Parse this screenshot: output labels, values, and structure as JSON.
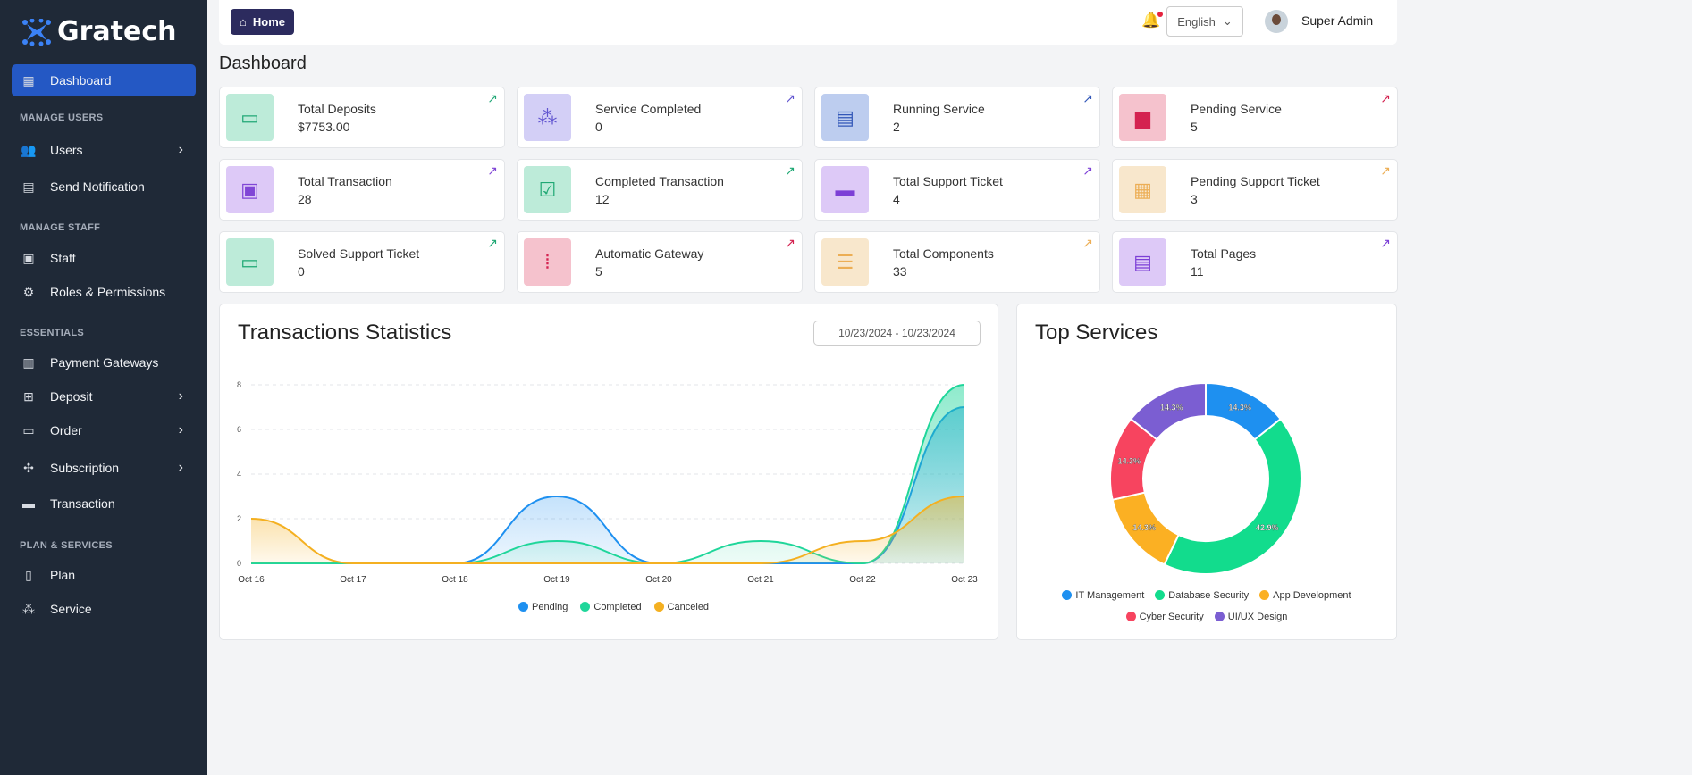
{
  "brand": "Gratech",
  "sidebar": {
    "items": [
      {
        "label": "Dashboard",
        "icon": "dashboard-icon",
        "glyph": "▦",
        "y": 72,
        "active": true
      },
      {
        "section": "MANAGE USERS",
        "y": 126
      },
      {
        "label": "Users",
        "icon": "users-icon",
        "glyph": "👥",
        "y": 150,
        "chevron": true
      },
      {
        "label": "Send Notification",
        "icon": "notification-icon",
        "glyph": "▤",
        "y": 191
      },
      {
        "section": "MANAGE STAFF",
        "y": 249
      },
      {
        "label": "Staff",
        "icon": "staff-icon",
        "glyph": "▣",
        "y": 271
      },
      {
        "label": "Roles & Permissions",
        "icon": "roles-icon",
        "glyph": "⚙",
        "y": 309
      },
      {
        "section": "ESSENTIALS",
        "y": 367
      },
      {
        "label": "Payment Gateways",
        "icon": "payment-gateway-icon",
        "glyph": "▥",
        "y": 388
      },
      {
        "label": "Deposit",
        "icon": "deposit-icon",
        "glyph": "⊞",
        "y": 426,
        "chevron": true
      },
      {
        "label": "Order",
        "icon": "order-icon",
        "glyph": "▭",
        "y": 464,
        "chevron": true
      },
      {
        "label": "Subscription",
        "icon": "subscription-icon",
        "glyph": "✣",
        "y": 506,
        "chevron": true
      },
      {
        "label": "Transaction",
        "icon": "transaction-icon",
        "glyph": "▬",
        "y": 546
      },
      {
        "section": "PLAN & SERVICES",
        "y": 605
      },
      {
        "label": "Plan",
        "icon": "plan-icon",
        "glyph": "▯",
        "y": 626
      },
      {
        "label": "Service",
        "icon": "service-icon",
        "glyph": "⁂",
        "y": 664
      }
    ]
  },
  "topbar": {
    "home": "Home",
    "language": "English",
    "user": "Super Admin"
  },
  "page_title": "Dashboard",
  "cards": [
    {
      "title": "Total Deposits",
      "value": "$7753.00",
      "bg": "#bdebd9",
      "fg": "#22a877",
      "glyph": "▭"
    },
    {
      "title": "Service Completed",
      "value": "0",
      "bg": "#d3cff6",
      "fg": "#6155d0",
      "glyph": "⁂"
    },
    {
      "title": "Running Service",
      "value": "2",
      "bg": "#bdcdef",
      "fg": "#3257b8",
      "glyph": "▤"
    },
    {
      "title": "Pending Service",
      "value": "5",
      "bg": "#f5c2cd",
      "fg": "#d42250",
      "glyph": "▆"
    },
    {
      "title": "Total Transaction",
      "value": "28",
      "bg": "#ddc9f7",
      "fg": "#8046d6",
      "glyph": "▣"
    },
    {
      "title": "Completed Transaction",
      "value": "12",
      "bg": "#bdebd9",
      "fg": "#1fa874",
      "glyph": "☑"
    },
    {
      "title": "Total Support Ticket",
      "value": "4",
      "bg": "#ddc9f7",
      "fg": "#7c3fd6",
      "glyph": "▬"
    },
    {
      "title": "Pending Support Ticket",
      "value": "3",
      "bg": "#f8e7cc",
      "fg": "#ecae55",
      "glyph": "▦"
    },
    {
      "title": "Solved Support Ticket",
      "value": "0",
      "bg": "#bdebd9",
      "fg": "#1fa874",
      "glyph": "▭"
    },
    {
      "title": "Automatic Gateway",
      "value": "5",
      "bg": "#f5c2cd",
      "fg": "#d42250",
      "glyph": "⦙"
    },
    {
      "title": "Total Components",
      "value": "33",
      "bg": "#f8e7cc",
      "fg": "#ecae55",
      "glyph": "☰"
    },
    {
      "title": "Total Pages",
      "value": "11",
      "bg": "#ddc9f7",
      "fg": "#7c3fd6",
      "glyph": "▤"
    }
  ],
  "transactions": {
    "title": "Transactions Statistics",
    "date_range": "10/23/2024 - 10/23/2024"
  },
  "top_services": {
    "title": "Top Services"
  },
  "chart_data": [
    {
      "type": "area",
      "title": "Transactions Statistics",
      "categories": [
        "Oct 16",
        "Oct 17",
        "Oct 18",
        "Oct 19",
        "Oct 20",
        "Oct 21",
        "Oct 22",
        "Oct 23"
      ],
      "ylim": [
        0,
        8
      ],
      "yticks": [
        "0",
        "2",
        "4",
        "6",
        "8"
      ],
      "grid": true,
      "legend": "bottom",
      "series": [
        {
          "name": "Pending",
          "color": "#1e90f0",
          "values": [
            0,
            0,
            0,
            3,
            0,
            0,
            0,
            7
          ]
        },
        {
          "name": "Completed",
          "color": "#1fd69a",
          "values": [
            0,
            0,
            0,
            1,
            0,
            1,
            0,
            8
          ]
        },
        {
          "name": "Canceled",
          "color": "#f4b021",
          "values": [
            2,
            0,
            0,
            0,
            0,
            0,
            1,
            3
          ]
        }
      ]
    },
    {
      "type": "pie",
      "title": "Top Services",
      "donut": true,
      "legend": "bottom",
      "labels": [
        "IT Management",
        "Database Security",
        "App Development",
        "Cyber Security",
        "UI/UX Design"
      ],
      "values": [
        14.3,
        42.9,
        14.3,
        14.3,
        14.3
      ],
      "display": [
        "14.3%",
        "42.9%",
        "14.3%",
        "14.3%",
        "14.3%"
      ],
      "colors": [
        "#1e90f0",
        "#12dc8d",
        "#fbb023",
        "#f7445f",
        "#7b5ed2"
      ]
    }
  ]
}
